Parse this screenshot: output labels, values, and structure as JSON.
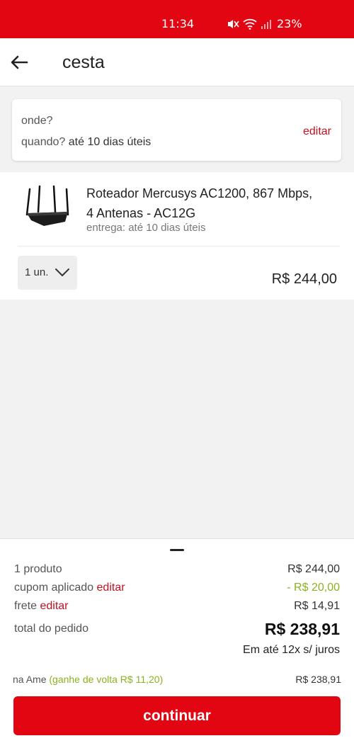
{
  "status_bar": {
    "time": "11:34",
    "battery": "23%",
    "icons": [
      "mute-icon",
      "wifi-icon",
      "signal-icon"
    ]
  },
  "header": {
    "title": "cesta",
    "back_icon": "arrow-left-icon"
  },
  "delivery": {
    "where_label": "onde?",
    "when_label": "quando?",
    "when_value": "até 10 dias úteis",
    "edit_label": "editar"
  },
  "cart_item": {
    "name": "Roteador Mercusys AC1200, 867 Mbps, 4 Antenas - AC12G",
    "delivery": "entrega: até 10 dias úteis",
    "quantity": "1 un.",
    "price": "R$ 244,00"
  },
  "summary": {
    "products_label": "1 produto",
    "products_value": "R$ 244,00",
    "coupon_label": "cupom aplicado",
    "coupon_edit": "editar",
    "coupon_value": "- R$ 20,00",
    "shipping_label": "frete",
    "shipping_edit": "editar",
    "shipping_value": "R$ 14,91",
    "total_label": "total do pedido",
    "total_value": "R$ 238,91",
    "installments": "Em até 12x s/ juros",
    "ame_label": "na Ame",
    "ame_cashback": "(ganhe de volta R$ 11,20)",
    "ame_value": "R$ 238,91",
    "continue_label": "continuar"
  },
  "colors": {
    "brand_red": "#e20613",
    "link_red": "#c2121f",
    "discount_green": "#8bb21e"
  }
}
